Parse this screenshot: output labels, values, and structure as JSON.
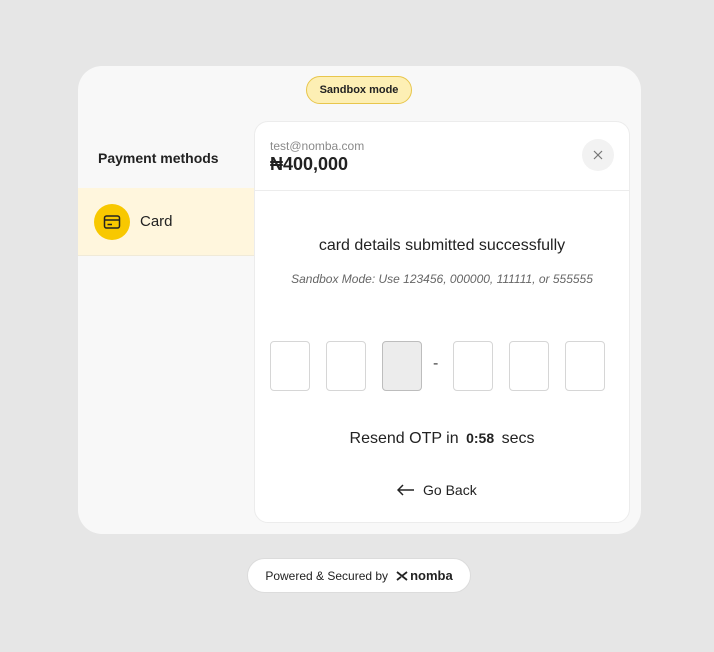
{
  "badge": {
    "label": "Sandbox mode"
  },
  "sidebar": {
    "title": "Payment methods",
    "items": [
      {
        "label": "Card",
        "icon": "card-icon",
        "selected": true
      }
    ]
  },
  "header": {
    "email": "test@nomba.com",
    "amount": "₦400,000",
    "close_icon": "close-icon"
  },
  "main": {
    "status": "card details submitted successfully",
    "hint": "Sandbox Mode: Use 123456, 000000, 111111, or 555555",
    "otp": {
      "separator": "-",
      "values": [
        "",
        "",
        "",
        "",
        "",
        ""
      ]
    },
    "resend_prefix": "Resend OTP in",
    "timer": "0:58",
    "resend_suffix": "secs",
    "back_label": "Go Back"
  },
  "footer": {
    "text": "Powered & Secured by",
    "brand": "nomba"
  },
  "colors": {
    "accent": "#f8c800",
    "selected_bg": "#fff6dd",
    "badge_bg": "#fdefb4"
  }
}
